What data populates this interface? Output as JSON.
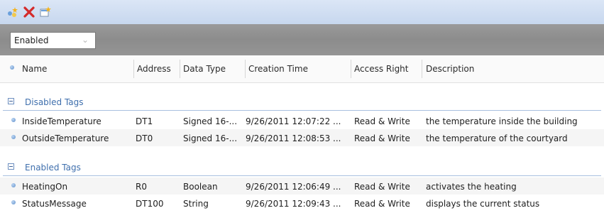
{
  "toolbar": {
    "icons": [
      "new-tag-icon",
      "delete-icon",
      "properties-icon"
    ]
  },
  "filter": {
    "selected": "Enabled"
  },
  "columns": [
    "Name",
    "Address",
    "Data Type",
    "Creation Time",
    "Access Right",
    "Description"
  ],
  "groups": [
    {
      "title": "Disabled Tags",
      "rows": [
        [
          "InsideTemperature",
          "DT1",
          "Signed 16-...",
          "9/26/2011 12:07:22 ...",
          "Read & Write",
          "the temperature inside the building"
        ],
        [
          "OutsideTemperature",
          "DT0",
          "Signed 16-...",
          "9/26/2011 12:08:53 ...",
          "Read & Write",
          "the temperature of the courtyard"
        ]
      ]
    },
    {
      "title": "Enabled Tags",
      "rows": [
        [
          "HeatingOn",
          "R0",
          "Boolean",
          "9/26/2011 12:06:49 ...",
          "Read & Write",
          "activates the heating"
        ],
        [
          "StatusMessage",
          "DT100",
          "String",
          "9/26/2011 12:09:43 ...",
          "Read & Write",
          "displays the current status"
        ]
      ]
    }
  ],
  "colors": {
    "group_title": "#3f6fad",
    "delete_red": "#d42a2a",
    "toolbar_bg": "#c7d7ee"
  }
}
